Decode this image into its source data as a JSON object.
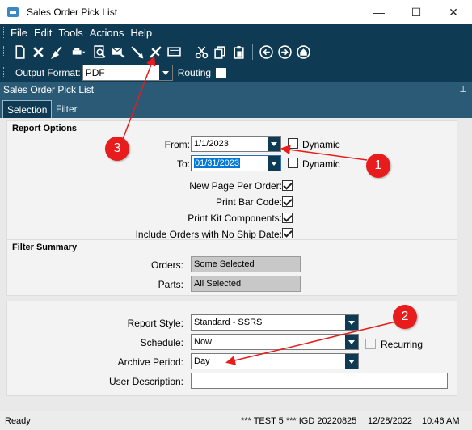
{
  "window": {
    "title": "Sales Order Pick List"
  },
  "menu": [
    "File",
    "Edit",
    "Tools",
    "Actions",
    "Help"
  ],
  "toolbar_icons": [
    "new-icon",
    "delete-icon",
    "clear-icon",
    "print-icon",
    "print-preview-icon",
    "send-icon",
    "submit-icon",
    "tools-icon",
    "screen-icon",
    "cut-icon",
    "copy-icon",
    "paste-icon",
    "back-icon",
    "forward-icon",
    "home-icon"
  ],
  "format_bar": {
    "output_label": "Output Format:",
    "output_value": "PDF",
    "routing_label": "Routing"
  },
  "panel_header": "Sales Order Pick List",
  "tabs": [
    {
      "label": "Selection"
    },
    {
      "label": "Filter"
    }
  ],
  "report_options": {
    "title": "Report Options",
    "from_label": "From:",
    "from_value": "1/1/2023",
    "to_label": "To:",
    "to_value": "01/31/2023",
    "dynamic_label": "Dynamic",
    "checks": [
      {
        "label": "New Page Per Order:",
        "checked": true
      },
      {
        "label": "Print Bar Code:",
        "checked": true
      },
      {
        "label": "Print Kit Components:",
        "checked": true
      },
      {
        "label": "Include Orders with No Ship Date:",
        "checked": true
      }
    ]
  },
  "filter_summary": {
    "title": "Filter Summary",
    "orders_label": "Orders:",
    "orders_value": "Some Selected",
    "parts_label": "Parts:",
    "parts_value": "All Selected"
  },
  "report_settings": {
    "style_label": "Report Style:",
    "style_value": "Standard - SSRS",
    "schedule_label": "Schedule:",
    "schedule_value": "Now",
    "recurring_label": "Recurring",
    "archive_label": "Archive Period:",
    "archive_value": "Day",
    "desc_label": "User Description:",
    "desc_value": ""
  },
  "status": {
    "left": "Ready",
    "env": "*** TEST 5 *** IGD 20220825",
    "date": "12/28/2022",
    "time": "10:46 AM"
  },
  "callouts": [
    "1",
    "2",
    "3"
  ],
  "colors": {
    "dark_bar": "#0e3a53",
    "panel": "#2b5a76",
    "callout": "#e81c1c"
  }
}
